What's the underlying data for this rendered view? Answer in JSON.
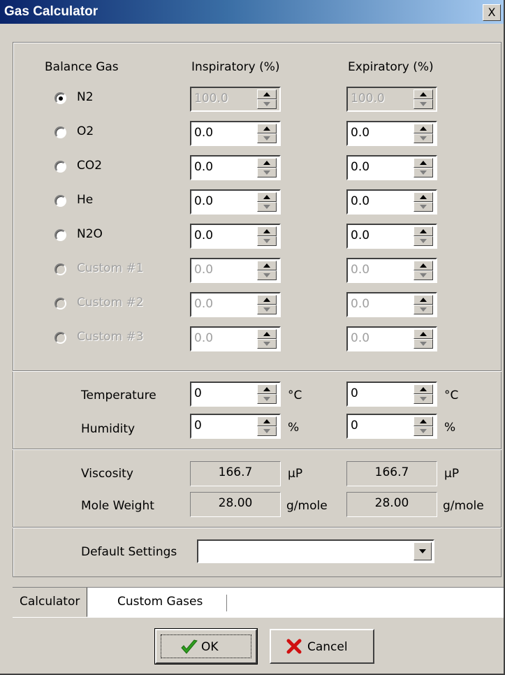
{
  "window": {
    "title": "Gas Calculator",
    "close_symbol": "X"
  },
  "headers": {
    "balance_gas": "Balance Gas",
    "inspiratory": "Inspiratory (%)",
    "expiratory": "Expiratory (%)"
  },
  "gases": [
    {
      "name": "N2",
      "selected": true,
      "enabled": true,
      "insp": "100.0",
      "exp": "100.0"
    },
    {
      "name": "O2",
      "selected": false,
      "enabled": true,
      "insp": "0.0",
      "exp": "0.0"
    },
    {
      "name": "CO2",
      "selected": false,
      "enabled": true,
      "insp": "0.0",
      "exp": "0.0"
    },
    {
      "name": "He",
      "selected": false,
      "enabled": true,
      "insp": "0.0",
      "exp": "0.0"
    },
    {
      "name": "N2O",
      "selected": false,
      "enabled": true,
      "insp": "0.0",
      "exp": "0.0"
    },
    {
      "name": "Custom #1",
      "selected": false,
      "enabled": false,
      "insp": "0.0",
      "exp": "0.0"
    },
    {
      "name": "Custom #2",
      "selected": false,
      "enabled": false,
      "insp": "0.0",
      "exp": "0.0"
    },
    {
      "name": "Custom #3",
      "selected": false,
      "enabled": false,
      "insp": "0.0",
      "exp": "0.0"
    }
  ],
  "conditions": {
    "temperature": {
      "label": "Temperature",
      "insp": "0",
      "exp": "0",
      "unit": "°C"
    },
    "humidity": {
      "label": "Humidity",
      "insp": "0",
      "exp": "0",
      "unit": "%"
    }
  },
  "results": {
    "viscosity": {
      "label": "Viscosity",
      "insp": "166.7",
      "exp": "166.7",
      "unit": "µP"
    },
    "mole_weight": {
      "label": "Mole Weight",
      "insp": "28.00",
      "exp": "28.00",
      "unit": "g/mole"
    }
  },
  "defaults": {
    "label": "Default Settings",
    "value": ""
  },
  "tabs": [
    {
      "label": "Calculator",
      "active": true
    },
    {
      "label": "Custom Gases",
      "active": false
    }
  ],
  "buttons": {
    "ok": "OK",
    "cancel": "Cancel"
  }
}
